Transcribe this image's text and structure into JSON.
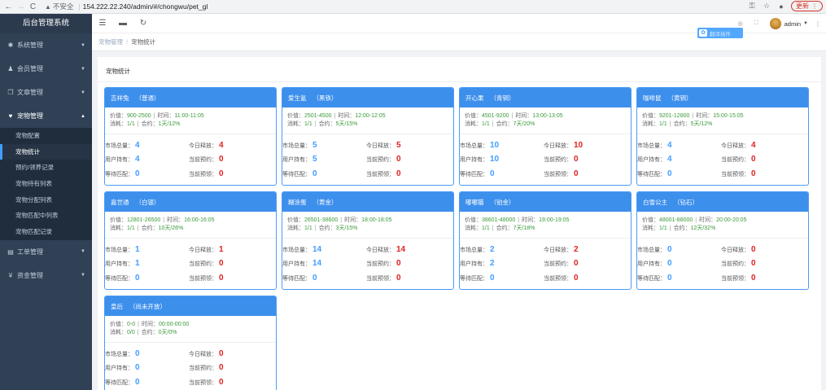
{
  "browser": {
    "security_label": "不安全",
    "url": "154.222.22.240/admin/#/chongwu/pet_gl",
    "update_label": "更新"
  },
  "sidebar": {
    "title": "后台管理系统",
    "menu": [
      {
        "label": "系统管理",
        "icon": "gear-icon",
        "open": false
      },
      {
        "label": "会员管理",
        "icon": "users-icon",
        "open": false
      },
      {
        "label": "文章管理",
        "icon": "copy-icon",
        "open": false
      },
      {
        "label": "宠物管理",
        "icon": "heart-icon",
        "open": true
      },
      {
        "label": "工单管理",
        "icon": "file-icon",
        "open": false
      },
      {
        "label": "资金管理",
        "icon": "yen-icon",
        "open": false
      }
    ],
    "submenu": [
      "宠物配置",
      "宠物统计",
      "预约/领养记录",
      "宠物持有列表",
      "宠物分配列表",
      "宠物匹配中列表",
      "宠物匹配记录"
    ],
    "active_sub": "宠物统计"
  },
  "topbar": {
    "user": "admin",
    "badge_text": "翻译插件"
  },
  "breadcrumb": {
    "root": "宠物管理",
    "sep": "/",
    "current": "宠物统计"
  },
  "section_title": "宠物统计",
  "labels": {
    "price": "价值：",
    "time": "时间：",
    "cost": "消耗：",
    "contract": "合约：",
    "market_total": "市场总量：",
    "user_hold": "用户持有：",
    "waiting_match": "等待匹配：",
    "today_release": "今日释放：",
    "current_reserve": "当前预约：",
    "current_claim": "当前预领："
  },
  "pets": [
    {
      "name": "吉祥兔",
      "level": "（普通）",
      "price": "900-2500",
      "time": "11:00-11:05",
      "cost": "1/1",
      "contract": "1天/12%",
      "market": "4",
      "hold": "4",
      "wait": "0",
      "release": "4",
      "reserve": "0",
      "claim": "0"
    },
    {
      "name": "爱生氪",
      "level": "（黑铁）",
      "price": "2501-4500",
      "time": "12:00-12:05",
      "cost": "1/1",
      "contract": "5天/15%",
      "market": "5",
      "hold": "5",
      "wait": "0",
      "release": "5",
      "reserve": "0",
      "claim": "0"
    },
    {
      "name": "开心果",
      "level": "（青铜）",
      "price": "4501-9200",
      "time": "13:00-13:05",
      "cost": "1/1",
      "contract": "7天/20%",
      "market": "10",
      "hold": "10",
      "wait": "0",
      "release": "10",
      "reserve": "0",
      "claim": "0"
    },
    {
      "name": "咖啡鼠",
      "level": "（黄铜）",
      "price": "9201-12800",
      "time": "15:00-15:05",
      "cost": "1/1",
      "contract": "5天/12%",
      "market": "4",
      "hold": "4",
      "wait": "0",
      "release": "4",
      "reserve": "0",
      "claim": "0"
    },
    {
      "name": "嘉世通",
      "level": "（白银）",
      "price": "12801-26500",
      "time": "16:00-16:05",
      "cost": "1/1",
      "contract": "10天/26%",
      "market": "1",
      "hold": "1",
      "wait": "0",
      "release": "1",
      "reserve": "0",
      "claim": "0"
    },
    {
      "name": "糊涂蛋",
      "level": "（黄金）",
      "price": "26501-38600",
      "time": "18:00-18:05",
      "cost": "1/1",
      "contract": "3天/15%",
      "market": "14",
      "hold": "14",
      "wait": "0",
      "release": "14",
      "reserve": "0",
      "claim": "0"
    },
    {
      "name": "嘟嘟猫",
      "level": "（铂金）",
      "price": "38601-48000",
      "time": "19:00-19:05",
      "cost": "1/1",
      "contract": "7天/18%",
      "market": "2",
      "hold": "2",
      "wait": "0",
      "release": "2",
      "reserve": "0",
      "claim": "0"
    },
    {
      "name": "白雪公主",
      "level": "（钻石）",
      "price": "48001-88000",
      "time": "20:00-20:05",
      "cost": "1/1",
      "contract": "12天/32%",
      "market": "0",
      "hold": "0",
      "wait": "0",
      "release": "0",
      "reserve": "0",
      "claim": "0"
    },
    {
      "name": "皇后",
      "level": "（尚未开放）",
      "price": "0-0",
      "time": "00:00-00:00",
      "cost": "0/0",
      "contract": "0天/0%",
      "market": "0",
      "hold": "0",
      "wait": "0",
      "release": "0",
      "reserve": "0",
      "claim": "0"
    }
  ]
}
